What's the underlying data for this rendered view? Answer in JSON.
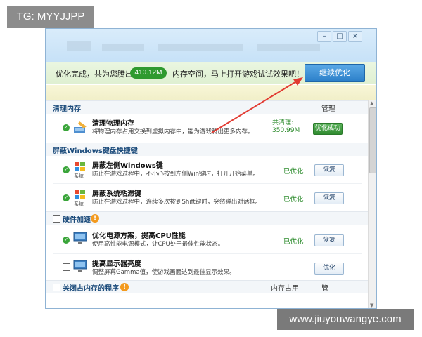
{
  "watermark_top": "TG: MYYJJPP",
  "watermark_bottom": "www.jiuyouwangye.com",
  "banner": {
    "prefix": "优化完成，共为您腾出",
    "amount": "410.12M",
    "suffix": "内存空间，马上打开游戏试试效果吧！",
    "continue_button": "继续优化"
  },
  "sections": {
    "mem": {
      "title": "清理内存",
      "manage": "管理"
    },
    "keys": {
      "title": "屏蔽Windows键盘快捷键"
    },
    "hw": {
      "title": "硬件加速"
    },
    "procs": {
      "title": "关闭占内存的程序",
      "col1": "内存占用",
      "col2": "管"
    }
  },
  "items": {
    "clean": {
      "title": "清理物理内存",
      "desc": "将物理内存占用交换到虚拟内存中，能为游戏腾出更多内存。",
      "cleared_label": "共清理:",
      "cleared_value": "350.99M",
      "button": "优化成功"
    },
    "winkey": {
      "title": "屏蔽左侧Windows键",
      "desc": "防止在游戏过程中，不小心按到左侧Win键时，打开开始菜单。",
      "status": "已优化",
      "button": "恢复"
    },
    "sticky": {
      "title": "屏蔽系统粘滞键",
      "desc": "防止在游戏过程中，连续多次按到Shift键时，突然弹出对话框。",
      "status": "已优化",
      "button": "恢复"
    },
    "power": {
      "title": "优化电源方案，提高CPU性能",
      "desc": "使用高性能电源模式，让CPU处于最佳性能状态。",
      "status": "已优化",
      "button": "恢复"
    },
    "gamma": {
      "title": "提高显示器亮度",
      "desc": "调整屏幕Gamma值，使游戏画面达到最佳显示效果。",
      "button": "优化"
    }
  },
  "icon_label": "系统",
  "colors": {
    "accent_green": "#3aa53a",
    "accent_blue": "#2b7fc9",
    "arrow_red": "#e23b32"
  }
}
